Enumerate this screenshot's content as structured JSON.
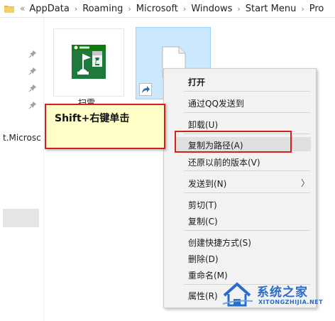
{
  "address_bar": {
    "lead": "«",
    "crumbs": [
      "AppData",
      "Roaming",
      "Microsoft",
      "Windows",
      "Start Menu",
      "Pro"
    ]
  },
  "navigation": {
    "truncated_item": "t.Microsc"
  },
  "files": [
    {
      "label": "扫雷"
    }
  ],
  "callout": {
    "text": "Shift+右键单击"
  },
  "context_menu": {
    "items": [
      {
        "label": "打开"
      },
      {
        "label": "通过QQ发送到"
      },
      {
        "label": "卸载(U)"
      },
      {
        "label": "复制为路径(A)"
      },
      {
        "label": "还原以前的版本(V)"
      },
      {
        "label": "发送到(N)"
      },
      {
        "label": "剪切(T)"
      },
      {
        "label": "复制(C)"
      },
      {
        "label": "创建快捷方式(S)"
      },
      {
        "label": "删除(D)"
      },
      {
        "label": "重命名(M)"
      },
      {
        "label": "属性(R)"
      }
    ],
    "submenu_arrow": "〉"
  },
  "watermark": {
    "cn": "系统之家",
    "en": "XITONGZHIJIA.NET"
  },
  "colors": {
    "highlight_box": "#d62020",
    "callout_bg": "#ffffc8",
    "selection": "#cce8ff"
  },
  "icons": [
    "folder-icon",
    "pin-icon",
    "xbox-minesweeper-icon",
    "document-icon",
    "shortcut-arrow-icon",
    "chevron-right-icon"
  ]
}
